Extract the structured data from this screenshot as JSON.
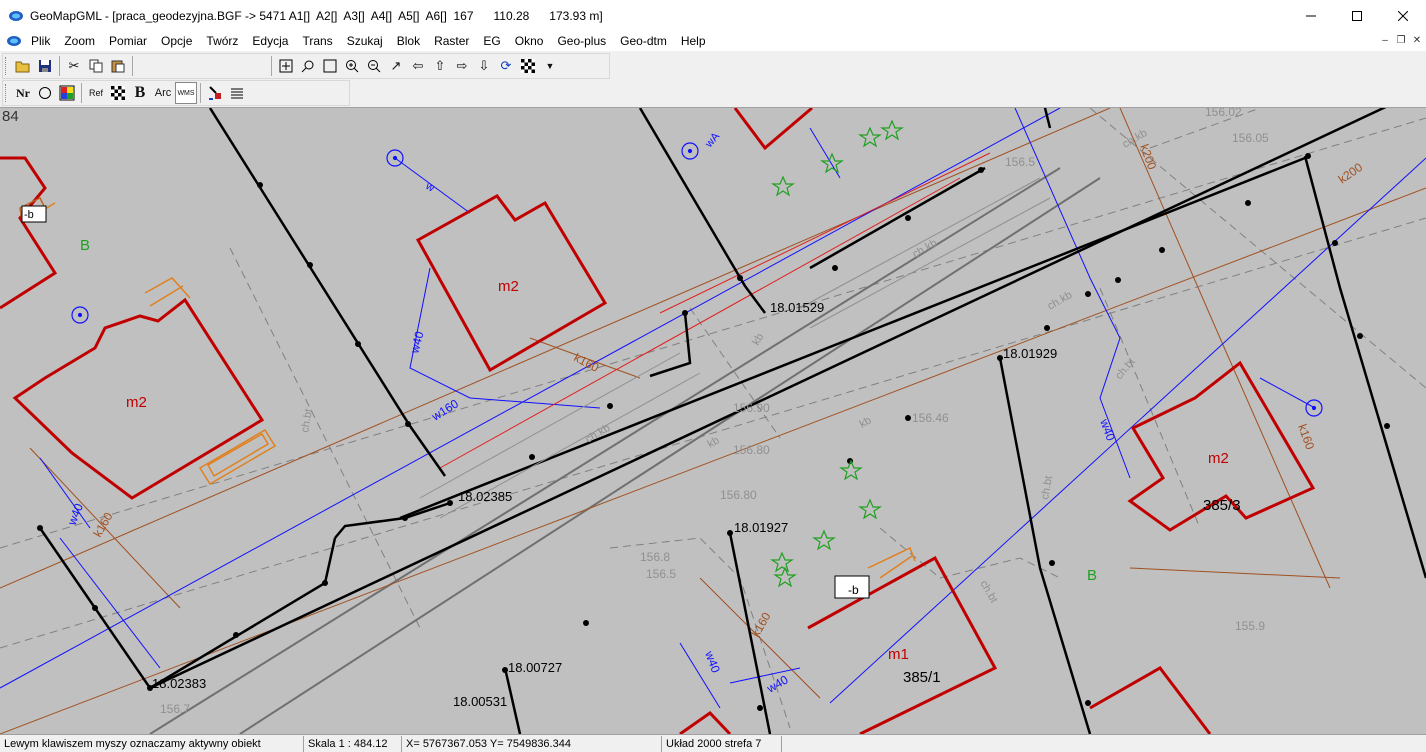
{
  "window": {
    "title": "GeoMapGML - [praca_geodezyjna.BGF -> 5471 A1[]  A2[]  A3[]  A4[]  A5[]  A6[]  167      110.28      173.93 m]"
  },
  "menu": [
    "Plik",
    "Zoom",
    "Pomiar",
    "Opcje",
    "Twórz",
    "Edycja",
    "Trans",
    "Szukaj",
    "Blok",
    "Raster",
    "EG",
    "Okno",
    "Geo-plus",
    "Geo-dtm",
    "Help"
  ],
  "toolbar2": {
    "nr_label": "Nr",
    "ref_label": "Ref",
    "b_label": "B",
    "arc_label": "Arc",
    "wms_label": "WMS"
  },
  "map": {
    "corner_label": "84",
    "labels": {
      "m2_a": "m2",
      "m2_b": "m2",
      "m2_c": "m2",
      "m1": "m1",
      "parcel_3853": "385/3",
      "parcel_3851": "385/1",
      "b1": "B",
      "b2": "B",
      "p1529": "18.01529",
      "p1929": "18.01929",
      "p2385": "18.02385",
      "p1927": "18.01927",
      "p2383": "18.02383",
      "p0727": "18.00727",
      "p0531": "18.00531",
      "h1": "156.90",
      "h2": "156.80",
      "h3": "156.80",
      "h4": "156.46",
      "h5": "156.8",
      "h6": "156.5",
      "h7": "156.7",
      "h8": "155.9",
      "h9": "156.02",
      "h10": "156.05",
      "h11": "156.5",
      "w40_a": "w40",
      "w40_b": "w40",
      "w40_c": "w40",
      "w40_d": "w40",
      "w160": "w160",
      "k160_a": "k160",
      "k160_b": "k160",
      "k160_c": "k160",
      "k200_a": "k200",
      "k200_b": "k200",
      "kp": "kp",
      "w": "w",
      "b_small1": "-b",
      "b_small2": "-b",
      "chbt1": "ch.bt",
      "chbt2": "ch.bt",
      "chbt3": "ch.bt",
      "chbt4": "ch.bt",
      "chkb1": "ch.kb",
      "chkb2": "ch.kb",
      "chkb3": "ch.kb",
      "kb1": "kb",
      "kb2": "kb",
      "kb3": "kb",
      "wA": "wA",
      "r11": "ch.bt"
    }
  },
  "status": {
    "hint": "Lewym klawiszem myszy oznaczamy aktywny obiekt",
    "scale": "Skala 1 : 484.12",
    "coords": "X=  5767367.053  Y=  7549836.344",
    "system": "Układ 2000 strefa 7"
  },
  "colors": {
    "map_bg": "#c0c0c0",
    "building": "#c00000",
    "water": "#1010ff",
    "sewer": "#a05020",
    "road": "#000000",
    "tree": "#20a020"
  }
}
